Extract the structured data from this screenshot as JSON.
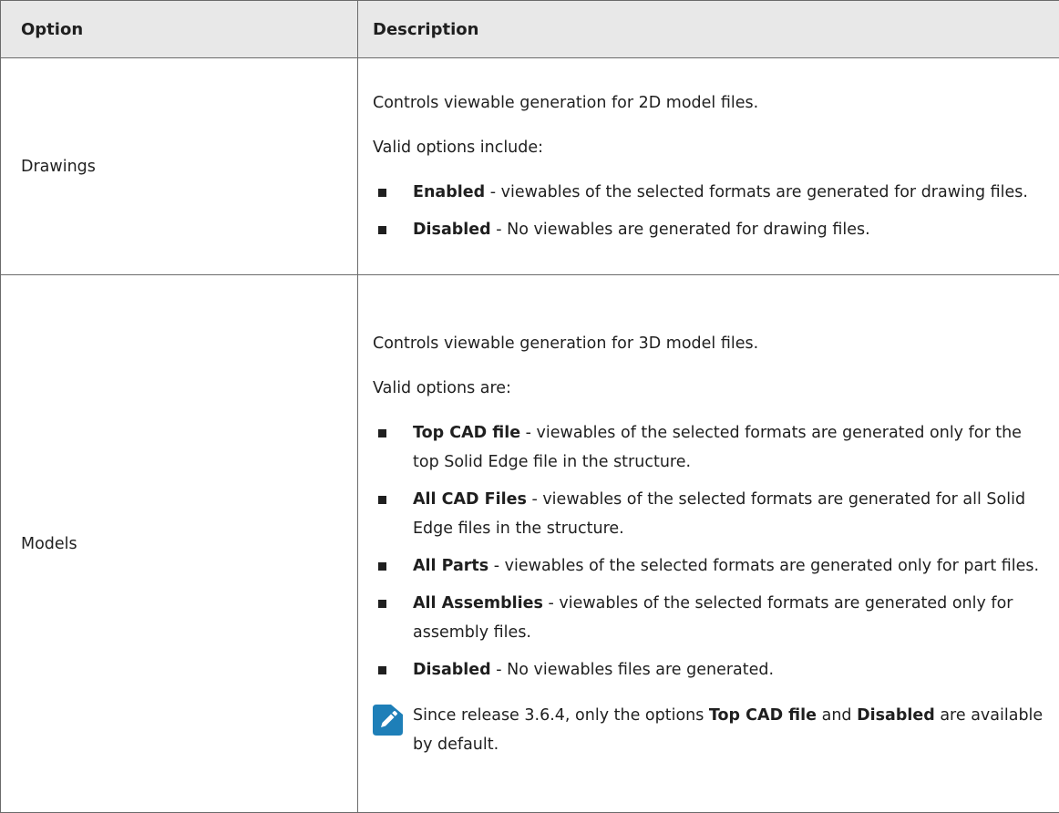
{
  "table": {
    "headers": {
      "option": "Option",
      "description": "Description"
    },
    "drawings": {
      "option": "Drawings",
      "intro": "Controls viewable generation for 2D model files.",
      "valid": "Valid options include:",
      "items": [
        {
          "term": "Enabled",
          "text": " - viewables of the selected formats are generated for drawing files."
        },
        {
          "term": "Disabled",
          "text": " - No viewables are generated for drawing files."
        }
      ]
    },
    "models": {
      "option": "Models",
      "intro": "Controls viewable generation for 3D model files.",
      "valid": "Valid options are:",
      "items": [
        {
          "term": "Top CAD file",
          "text": " - viewables of the selected formats are generated only for the top Solid Edge file in the structure."
        },
        {
          "term": "All CAD Files",
          "text": " - viewables of the selected formats are generated for all Solid Edge files in the structure."
        },
        {
          "term": "All Parts",
          "text": " - viewables of the selected formats are generated only for part files."
        },
        {
          "term": "All Assemblies",
          "text": " - viewables of the selected formats are generated only for assembly files."
        },
        {
          "term": "Disabled",
          "text": " - No viewables files are generated."
        }
      ],
      "note": {
        "icon": "pencil-note-icon",
        "part1": "Since release 3.6.4, only the options ",
        "term1": "Top CAD file",
        "part2": " and ",
        "term2": "Disabled",
        "part3": " are available by default."
      }
    }
  },
  "colors": {
    "header_bg": "#e8e8e8",
    "border": "#6b6b6b",
    "note_icon": "#1e7fb8"
  }
}
